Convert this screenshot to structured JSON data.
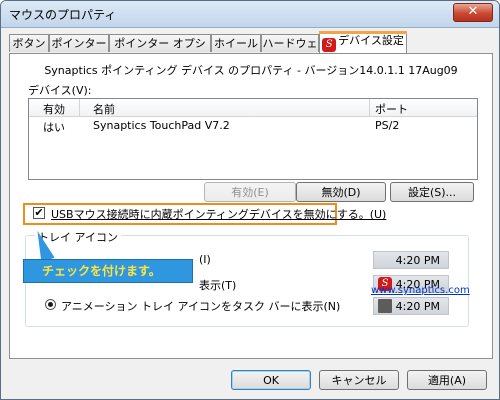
{
  "window": {
    "title": "マウスのプロパティ",
    "close_label": "✕"
  },
  "tabs": [
    {
      "label": "ボタン"
    },
    {
      "label": "ポインター"
    },
    {
      "label": "ポインター オプション"
    },
    {
      "label": "ホイール"
    },
    {
      "label": "ハードウェア"
    },
    {
      "label": "デバイス設定",
      "active": true,
      "icon": "synaptics-icon"
    }
  ],
  "panel": {
    "properties_text": "Synaptics ポインティング デバイス のプロパティ - バージョン14.0.1.1 17Aug09",
    "device_label": "デバイス(V):",
    "table": {
      "headers": [
        "有効",
        "名前",
        "ポート"
      ],
      "rows": [
        {
          "enabled": "はい",
          "name": "Synaptics TouchPad V7.2",
          "port": "PS/2"
        }
      ]
    },
    "buttons": {
      "enable": "有効(E)",
      "disable": "無効(D)",
      "settings": "設定(S)..."
    },
    "checkbox": {
      "checked": true,
      "mark": "✔",
      "label": "USBマウス接続時に内蔵ポインティングデバイスを無効にする。(U)"
    },
    "tray_group": {
      "title": "トレイ アイコン",
      "options": [
        {
          "label": "アイコンをタスク バーに表示(T)",
          "checked": false
        },
        {
          "label": "アニメーション トレイ アイコンをタスク バーに表示(N)",
          "checked": true
        }
      ],
      "partial_labels": [
        "(I)",
        "表示(T)"
      ],
      "previews": [
        {
          "time": "4:20 PM",
          "icon": "none"
        },
        {
          "time": "4:20 PM",
          "icon": "synaptics-icon"
        },
        {
          "time": "4:20 PM",
          "icon": "animated-touchpad-icon"
        }
      ]
    },
    "link": "www.synaptics.com"
  },
  "callout": {
    "text": "チェックを付けます。",
    "color": "#2f97e0",
    "text_color": "#ffe53b"
  },
  "highlight_color": "#f08c1e",
  "footer": {
    "ok": "OK",
    "cancel": "キャンセル",
    "apply": "適用(A)"
  }
}
